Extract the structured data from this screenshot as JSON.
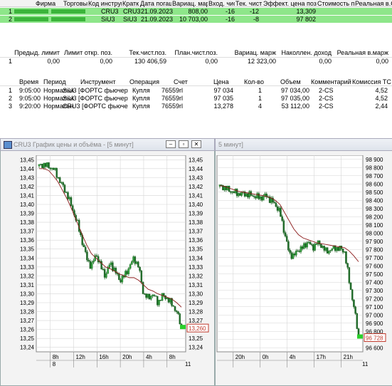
{
  "positions_table": {
    "headers": [
      "Фирма",
      "Торговый сч",
      "Код инструм",
      "Кратк",
      "Дата погаш",
      "Вариац. марж",
      "Вход. чис",
      "Тек. чист",
      "Эффект. цена поз.",
      "Стоимость пс",
      "Реальная в.С"
    ],
    "rows": [
      {
        "num": "1",
        "code": "CRU3",
        "short": "CRU3",
        "date": "21.09.2023",
        "vm": "808,00",
        "in": "-16",
        "cur": "-12",
        "eff": "13,309"
      },
      {
        "num": "2",
        "code": "SiU3",
        "short": "SiU3",
        "date": "21.09.2023",
        "vm": "10 703,00",
        "in": "-16",
        "cur": "-8",
        "eff": "97 802"
      }
    ]
  },
  "limits_table": {
    "headers": [
      "Предыд. лимит",
      "Лимит откр. поз.",
      "Тек.чист.поз.",
      "План.чист.поз.",
      "Вариац. марж",
      "Наколлен. доход",
      "Реальная в.марж"
    ],
    "row": {
      "num": "1",
      "prev": "0,00",
      "open": "0,00",
      "cur": "130 406,59",
      "plan": "0,00",
      "vm": "12 323,00",
      "acc": "0,00",
      "real": "0,00"
    }
  },
  "trades_table": {
    "headers": [
      "Время",
      "Период",
      "Инструмент",
      "Операция",
      "Счет",
      "Цена",
      "Кол-во",
      "Объем",
      "Комментарий",
      "Комиссия ТС"
    ],
    "rows": [
      {
        "num": "1",
        "time": "9:05:00",
        "period": "Нормальн",
        "instr": "SiU3 [ФОРТС фьючерс]",
        "op": "Купля",
        "acct": "76559rl",
        "price": "97 034",
        "qty": "1",
        "vol": "97 034,00",
        "comment": "2-CS",
        "fee": "4,52"
      },
      {
        "num": "2",
        "time": "9:05:00",
        "period": "Нормальн",
        "instr": "SiU3 [ФОРТС фьючерс]",
        "op": "Купля",
        "acct": "76559rl",
        "price": "97 035",
        "qty": "1",
        "vol": "97 035,00",
        "comment": "2-CS",
        "fee": "4,52"
      },
      {
        "num": "3",
        "time": "9:20:00",
        "period": "Нормальн",
        "instr": "CRU3 [ФОРТС фьючерс]",
        "op": "Купля",
        "acct": "76559rl",
        "price": "13,278",
        "qty": "4",
        "vol": "53 112,00",
        "comment": "2-CS",
        "fee": "2,44"
      }
    ]
  },
  "chart_windows": [
    {
      "title": "CRU3 График цены и объёма - [5 минут]"
    },
    {
      "title": "5 минут]"
    }
  ],
  "chart_data": [
    {
      "type": "candlestick",
      "ylim": [
        13.235,
        13.455
      ],
      "yticks": [
        "13,45",
        "13,44",
        "13,43",
        "13,42",
        "13,41",
        "13,40",
        "13,39",
        "13,38",
        "13,37",
        "13,36",
        "13,35",
        "13,34",
        "13,33",
        "13,32",
        "13,31",
        "13,30",
        "13,29",
        "13,28",
        "13,27",
        "13,26",
        "13,25",
        "13,24"
      ],
      "xticks": [
        "8h",
        "12h",
        "16h",
        "20h",
        "4h",
        "8h"
      ],
      "date_labels": [
        "8",
        "11"
      ],
      "last_price_label": "13,260",
      "price_path": [
        13.443,
        13.445,
        13.442,
        13.44,
        13.43,
        13.42,
        13.41,
        13.395,
        13.38,
        13.36,
        13.34,
        13.33,
        13.345,
        13.33,
        13.32,
        13.335,
        13.325,
        13.315,
        13.32,
        13.33,
        13.34,
        13.33,
        13.3,
        13.295,
        13.3,
        13.29,
        13.298,
        13.295,
        13.288,
        13.28,
        13.262
      ],
      "ma_path": [
        13.44,
        13.44,
        13.438,
        13.432,
        13.425,
        13.415,
        13.405,
        13.393,
        13.38,
        13.367,
        13.355,
        13.345,
        13.34,
        13.335,
        13.33,
        13.328,
        13.325,
        13.322,
        13.32,
        13.318,
        13.318,
        13.315,
        13.31,
        13.305,
        13.303,
        13.3,
        13.298,
        13.296,
        13.294,
        13.29,
        13.285
      ]
    },
    {
      "type": "candlestick",
      "ylim": [
        96550,
        98950
      ],
      "yticks": [
        "98 900",
        "98 800",
        "98 700",
        "98 600",
        "98 500",
        "98 400",
        "98 300",
        "98 200",
        "98 100",
        "98 000",
        "97 900",
        "97 800",
        "97 700",
        "97 600",
        "97 500",
        "97 400",
        "97 300",
        "97 200",
        "97 100",
        "97 000",
        "96 900",
        "96 800",
        "96 700",
        "96 600"
      ],
      "xticks": [
        "20h",
        "0h",
        "4h",
        "17h",
        "21h"
      ],
      "date_labels": [
        "11"
      ],
      "last_price_label": "96 728",
      "price_path": [
        98570,
        98560,
        98520,
        98500,
        98480,
        98480,
        98470,
        98460,
        98440,
        98430,
        98460,
        98400,
        98350,
        98250,
        98000,
        97750,
        97720,
        97800,
        97820,
        97900,
        97820,
        97880,
        97850,
        97770,
        97800,
        97820,
        97810,
        97770,
        97400,
        97100,
        96728
      ],
      "ma_path": [
        98580,
        98570,
        98550,
        98530,
        98510,
        98500,
        98490,
        98480,
        98470,
        98460,
        98450,
        98430,
        98400,
        98350,
        98250,
        98150,
        98050,
        97980,
        97940,
        97920,
        97900,
        97880,
        97870,
        97860,
        97850,
        97840,
        97830,
        97820,
        97780,
        97720,
        97650
      ]
    }
  ],
  "colors": {
    "positive_row": "#8ee68a",
    "candle_up": "#2e9e3a",
    "candle_down": "#2e7d32",
    "ma_line": "#8b1a1a",
    "grid": "#c8c8c8",
    "marker_green": "#2bd02b",
    "price_box": "#c0392b"
  }
}
